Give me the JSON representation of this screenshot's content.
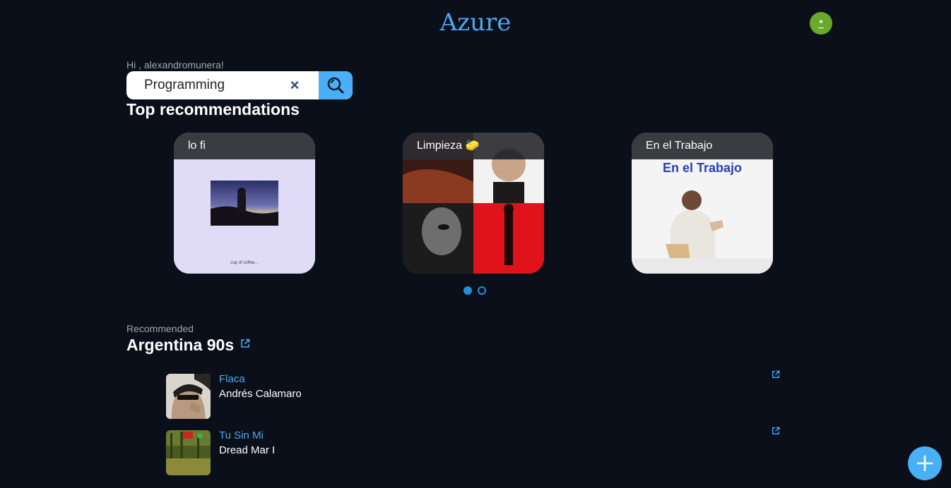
{
  "header": {
    "app_title": "Azure",
    "avatar_initial": "*"
  },
  "greeting": "Hi , alexandromunera!",
  "search": {
    "value": "Programming",
    "clear_icon": "×"
  },
  "top_recommendations": {
    "title": "Top recommendations",
    "cards": [
      {
        "title": "lo fi",
        "art_caption": "cup of coffee..."
      },
      {
        "title": "Limpieza 🧽"
      },
      {
        "title": "En el Trabajo",
        "art_text": "En el Trabajo"
      }
    ],
    "carousel_pages": 2,
    "carousel_active": 0
  },
  "recommended": {
    "label": "Recommended",
    "playlist_title": "Argentina 90s",
    "tracks": [
      {
        "name": "Flaca",
        "artist": "Andrés Calamaro"
      },
      {
        "name": "Tu Sin Mi",
        "artist": "Dread Mar I"
      }
    ]
  },
  "colors": {
    "accent": "#4aaaf0",
    "background": "#0b0f1a",
    "avatar": "#6aaa2a"
  },
  "icons": {
    "search": "search-icon",
    "clear": "close-icon",
    "external_link": "external-link-icon",
    "add": "plus-icon"
  }
}
